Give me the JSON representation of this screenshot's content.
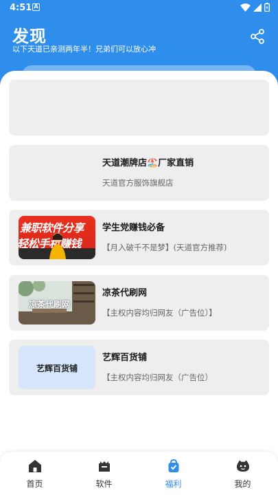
{
  "status_bar": {
    "time": "4:51",
    "notification_glyph": "A"
  },
  "header": {
    "title": "发现",
    "subtitle": "以下天道已亲测两年半！兄弟们可以放心冲",
    "accent_color": "#2F8EEB"
  },
  "cards": [
    {
      "title": "天道潮牌店🏖️厂家直销",
      "subtitle": "天道官方服饰旗舰店"
    },
    {
      "title": "学生党赚钱必备",
      "subtitle": "【月入破千不是梦】(天道官方推荐)",
      "thumb_text_1": "兼职软件分享",
      "thumb_text_2": "轻松手机赚钱"
    },
    {
      "title": "凉茶代刷网",
      "subtitle": "【主权内容均归网友（广告位）】",
      "thumb_text": "凉茶代刷网"
    },
    {
      "title": "艺辉百货铺",
      "subtitle": "【主权内容均归网友（广告位）",
      "thumb_text": "艺辉百货铺"
    }
  ],
  "bottom_nav": [
    {
      "label": "首页",
      "icon": "home-icon",
      "active": false
    },
    {
      "label": "软件",
      "icon": "box-icon",
      "active": false
    },
    {
      "label": "福利",
      "icon": "gift-bag-icon",
      "active": true
    },
    {
      "label": "我的",
      "icon": "profile-icon",
      "active": false
    }
  ]
}
